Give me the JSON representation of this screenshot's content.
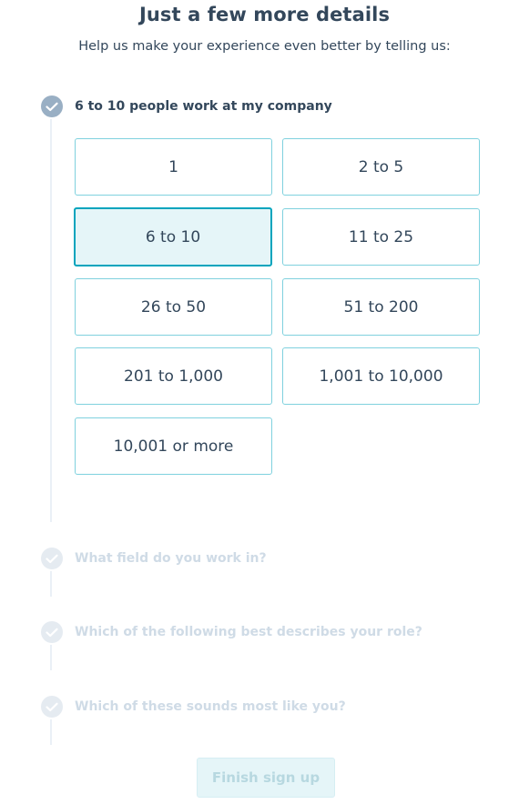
{
  "header": {
    "title": "Just a few more details",
    "subtitle": "Help us make your experience even better by telling us:"
  },
  "steps": [
    {
      "label": "6 to 10 people work at my company",
      "state": "completed",
      "icon": "check-icon",
      "options": [
        "1",
        "2 to 5",
        "6 to 10",
        "11 to 25",
        "26 to 50",
        "51 to 200",
        "201 to 1,000",
        "1,001 to 10,000",
        "10,001 or more"
      ],
      "selected": "6 to 10"
    },
    {
      "label": "What field do you work in?",
      "state": "pending",
      "icon": "check-icon"
    },
    {
      "label": "Which of the following best describes your role?",
      "state": "pending",
      "icon": "check-icon"
    },
    {
      "label": "Which of these sounds most like you?",
      "state": "pending",
      "icon": "check-icon"
    }
  ],
  "footer": {
    "finish_label": "Finish sign up",
    "finish_enabled": false
  },
  "colors": {
    "text": "#33475b",
    "accent": "#00a4bd",
    "option_border": "#7fd1de",
    "selected_bg": "#e5f5f8",
    "muted_text": "#cfdbe6"
  }
}
